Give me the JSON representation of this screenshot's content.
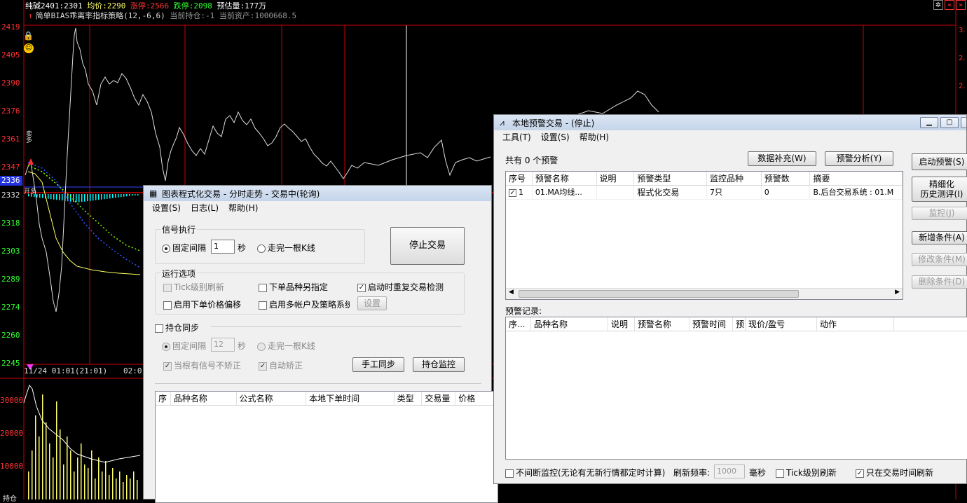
{
  "ticker": {
    "name": "纯碱2401:2301",
    "avg": "均价:2290",
    "limit_up": "涨停:2566",
    "limit_down": "跌停:2098",
    "est_volume": "预估量:177万"
  },
  "strategy": {
    "name": "简单BIAS乖离率指标策略(12,-6,6)",
    "position": "当前持仓:-1",
    "assets": "当前资产:1000668.5"
  },
  "price_axis": [
    "2419",
    "2405",
    "2390",
    "2376",
    "2361",
    "2347",
    "2332",
    "2318",
    "2303",
    "2289",
    "2274",
    "2260",
    "2245"
  ],
  "current_price": "2336",
  "volume_axis": [
    "30000",
    "20000",
    "10000"
  ],
  "time_labels": [
    "11/24 01:01(21:01)",
    "02:0"
  ],
  "chart_markers": {
    "buy_label": "开多",
    "pos_label": "卖多"
  },
  "bottom_label": "持仓",
  "colors": {
    "up": "#ff3333",
    "down": "#00ffff",
    "grid": "#cc0000",
    "price_line": "#dddddd",
    "avg_line": "#ffff66"
  },
  "win1": {
    "title": "图表程式化交易 - 分时走势 - 交易中(轮询)",
    "menu": [
      "设置(S)",
      "日志(L)",
      "帮助(H)"
    ],
    "signal_group": "信号执行",
    "fixed_interval": "固定间隔",
    "interval_value": "1",
    "seconds": "秒",
    "bar_complete": "走完一根K线",
    "stop_button": "停止交易",
    "run_options": "运行选项",
    "tick_refresh": "Tick级别刷新",
    "order_variety": "下单品种另指定",
    "restart_check": "启动时重复交易检测",
    "price_offset": "启用下单价格偏移",
    "multi_account": "启用多帐户及策略系统",
    "settings_button": "设置",
    "position_sync": "持仓同步",
    "sync_fixed_interval": "固定间隔",
    "sync_interval_value": "12",
    "sync_seconds": "秒",
    "sync_bar_complete": "走完一根K线",
    "no_correct": "当根有信号不矫正",
    "auto_correct": "自动矫正",
    "manual_sync": "手工同步",
    "position_monitor": "持仓监控",
    "table_headers": [
      "序",
      "品种名称",
      "公式名称",
      "本地下单时间",
      "类型",
      "交易量",
      "价格"
    ]
  },
  "win2": {
    "title": "本地预警交易 - (停止)",
    "menu": [
      "工具(T)",
      "设置(S)",
      "帮助(H)"
    ],
    "count_text": "共有 0 个预警",
    "data_supplement": "数据补充(W)",
    "alert_analysis": "预警分析(Y)",
    "start_alert": "启动预警(S)",
    "refine_line1": "精细化",
    "refine_line2": "历史测评(I)",
    "monitor": "监控(J)",
    "add_condition": "新增条件(A)",
    "modify_condition": "修改条件(M)",
    "delete_condition": "删除条件(D)",
    "table_headers": [
      "序号",
      "预警名称",
      "说明",
      "预警类型",
      "监控品种",
      "预警数",
      "摘要"
    ],
    "row": {
      "no": "1",
      "name": "01.MA均线...",
      "desc": "",
      "type": "程式化交易",
      "variety": "7只",
      "count": "0",
      "summary": "B.后台交易系统 : 01.M"
    },
    "records_label": "预警记录:",
    "record_headers": [
      "序...",
      "品种名称",
      "说明",
      "预警名称",
      "预警时间",
      "预",
      "现价/盈亏",
      "动作"
    ],
    "continuous_monitor": "不间断监控(无论有无新行情都定时计算)",
    "refresh_rate_label": "刷新频率:",
    "refresh_rate_value": "1000",
    "ms": "毫秒",
    "tick_refresh": "Tick级别刷新",
    "trading_hours_only": "只在交易时间刷新"
  }
}
